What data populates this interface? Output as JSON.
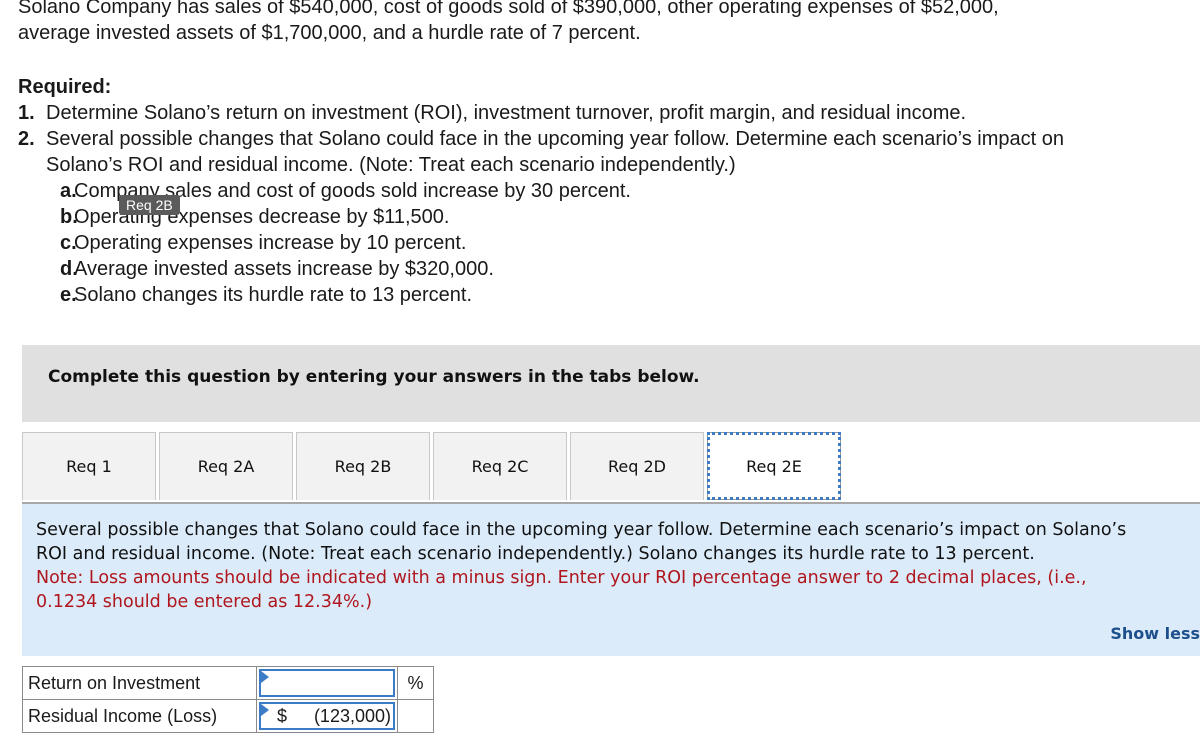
{
  "intro": {
    "line1": "Solano Company has sales of $540,000, cost of goods sold of $390,000, other operating expenses of $52,000,",
    "line2": "average invested assets of $1,700,000, and a hurdle rate of 7 percent."
  },
  "required": {
    "title": "Required:",
    "items": [
      {
        "num": "1.",
        "text": "Determine Solano’s return on investment (ROI), investment turnover, profit margin, and residual income."
      },
      {
        "num": "2.",
        "text": "Several possible changes that Solano could face in the upcoming year follow. Determine each scenario’s impact on",
        "text2": "Solano’s ROI and residual income. (Note: Treat each scenario independently.)"
      }
    ],
    "scenarios": [
      {
        "letter": "a.",
        "text": "Company sales and cost of goods sold increase by 30 percent."
      },
      {
        "letter": "b.",
        "text": "Operating expenses decrease by $11,500."
      },
      {
        "letter": "c.",
        "text": "Operating expenses increase by 10 percent."
      },
      {
        "letter": "d.",
        "text": "Average invested assets increase by $320,000."
      },
      {
        "letter": "e.",
        "text": "Solano changes its hurdle rate to 13 percent."
      }
    ]
  },
  "tooltip": "Req 2B",
  "banner": "Complete this question by entering your answers in the tabs below.",
  "tabs": [
    {
      "label": "Req 1"
    },
    {
      "label": "Req 2A"
    },
    {
      "label": "Req 2B"
    },
    {
      "label": "Req 2C"
    },
    {
      "label": "Req 2D"
    },
    {
      "label": "Req 2E",
      "active": true
    }
  ],
  "panel": {
    "line1": "Several possible changes that Solano could face in the upcoming year follow. Determine each scenario’s impact on Solano’s",
    "line2": "ROI and residual income. (Note: Treat each scenario independently.) Solano changes its hurdle rate to 13 percent.",
    "note1": "Note: Loss amounts should be indicated with a minus sign. Enter your ROI percentage answer to 2 decimal places, (i.e.,",
    "note2": "0.1234 should be entered as 12.34%.)",
    "show_less": "Show less"
  },
  "answer_table": {
    "rows": [
      {
        "label": "Return on Investment",
        "value": "",
        "unit": "%"
      },
      {
        "label": "Residual Income (Loss)",
        "prefix": "$",
        "value": "(123,000)",
        "unit": ""
      }
    ]
  },
  "colors": {
    "accent": "#3c7cc7",
    "note": "#b0161e",
    "panel_bg": "#dbebf9",
    "banner_bg": "#e0e0e0",
    "link": "#1d4f8c"
  }
}
